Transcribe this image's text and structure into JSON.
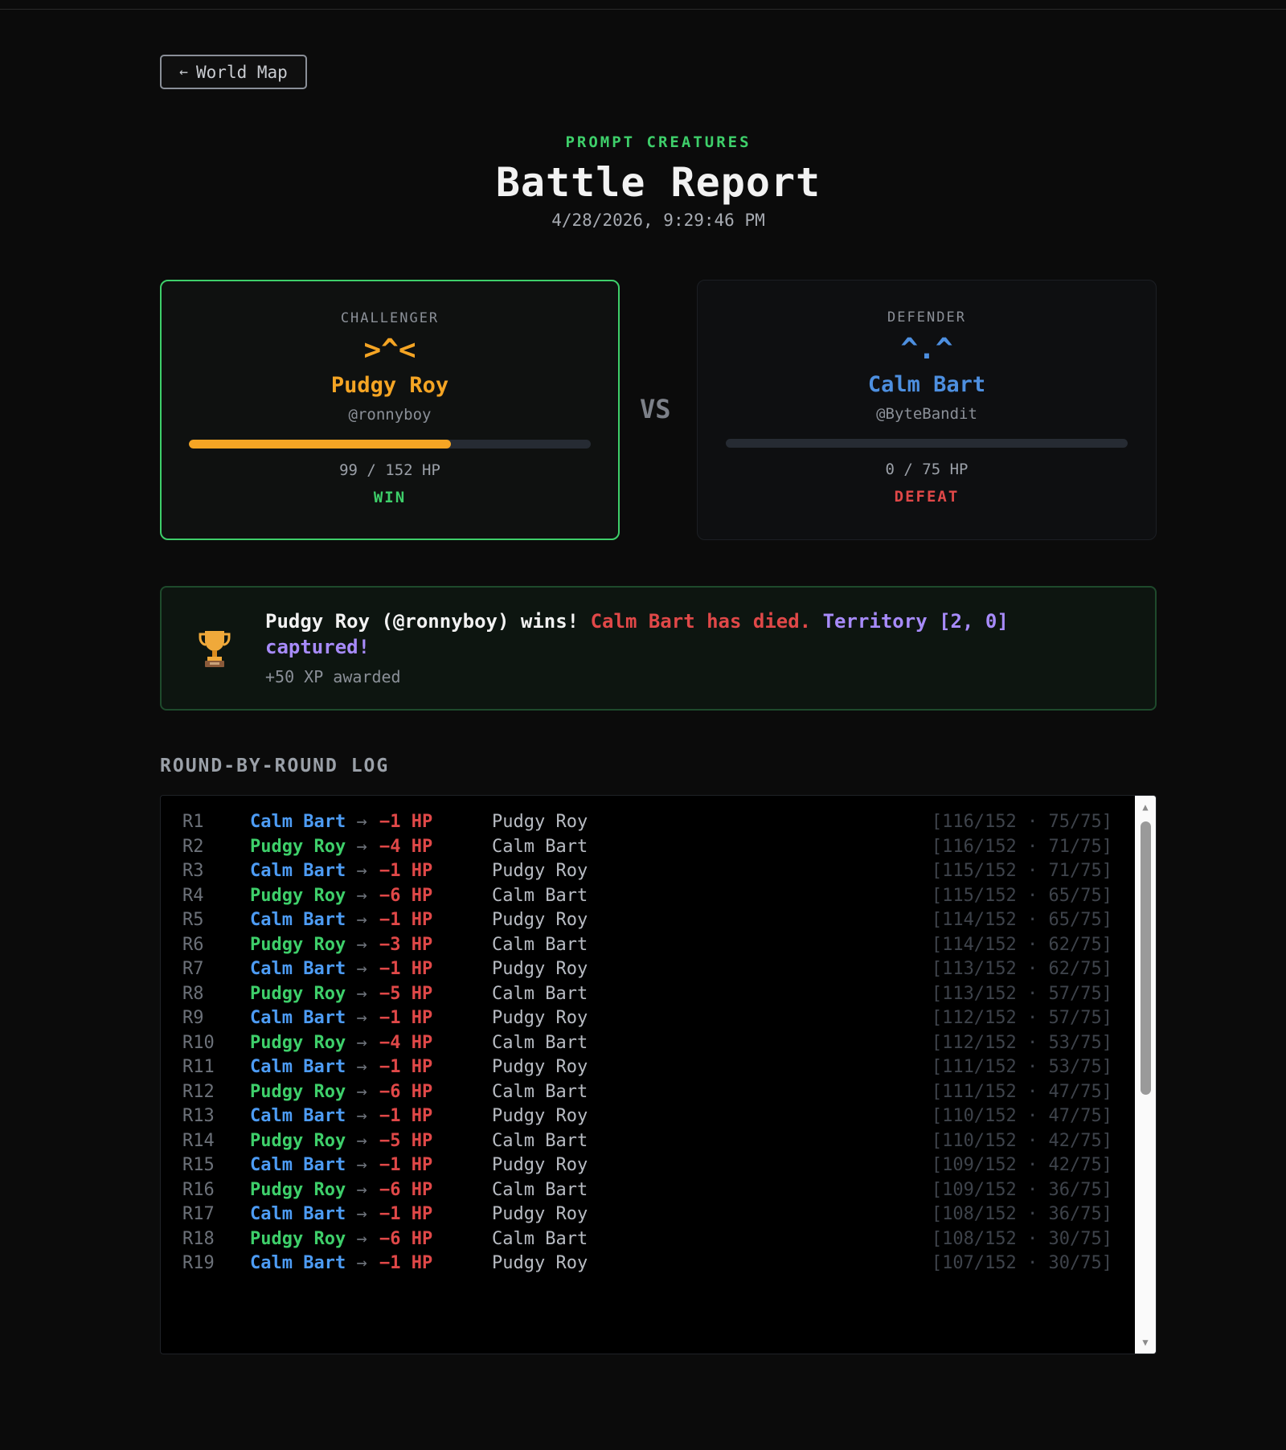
{
  "nav": {
    "back_arrow": "←",
    "back_label": "World Map"
  },
  "header": {
    "eyebrow": "PROMPT CREATURES",
    "title": "Battle Report",
    "date": "4/28/2026, 9:29:46 PM"
  },
  "challenger": {
    "role": "CHALLENGER",
    "face": ">^<",
    "name": "Pudgy Roy",
    "handle": "@ronnyboy",
    "hp_text": "99 / 152 HP",
    "hp_current": 99,
    "hp_max": 152,
    "outcome": "WIN",
    "color": "#f5a524"
  },
  "vs_label": "VS",
  "defender": {
    "role": "DEFENDER",
    "face": "^.^",
    "name": "Calm Bart",
    "handle": "@ByteBandit",
    "hp_text": "0 / 75 HP",
    "hp_current": 0,
    "hp_max": 75,
    "outcome": "DEFEAT",
    "color": "#4d8fe0"
  },
  "result": {
    "icon": "trophy-icon",
    "winner_text": "Pudgy Roy (@ronnyboy) wins!",
    "died_text": "Calm Bart has died.",
    "territory_text": "Territory [2, 0] captured!",
    "xp_text": "+50 XP awarded"
  },
  "log": {
    "title": "ROUND-BY-ROUND LOG",
    "arrow": "→",
    "rows": [
      {
        "round": "R1",
        "attacker": "Calm Bart",
        "side": "blue",
        "damage": "−1 HP",
        "target": "Pudgy Roy",
        "state": "[116/152 · 75/75]"
      },
      {
        "round": "R2",
        "attacker": "Pudgy Roy",
        "side": "green",
        "damage": "−4 HP",
        "target": "Calm Bart",
        "state": "[116/152 · 71/75]"
      },
      {
        "round": "R3",
        "attacker": "Calm Bart",
        "side": "blue",
        "damage": "−1 HP",
        "target": "Pudgy Roy",
        "state": "[115/152 · 71/75]"
      },
      {
        "round": "R4",
        "attacker": "Pudgy Roy",
        "side": "green",
        "damage": "−6 HP",
        "target": "Calm Bart",
        "state": "[115/152 · 65/75]"
      },
      {
        "round": "R5",
        "attacker": "Calm Bart",
        "side": "blue",
        "damage": "−1 HP",
        "target": "Pudgy Roy",
        "state": "[114/152 · 65/75]"
      },
      {
        "round": "R6",
        "attacker": "Pudgy Roy",
        "side": "green",
        "damage": "−3 HP",
        "target": "Calm Bart",
        "state": "[114/152 · 62/75]"
      },
      {
        "round": "R7",
        "attacker": "Calm Bart",
        "side": "blue",
        "damage": "−1 HP",
        "target": "Pudgy Roy",
        "state": "[113/152 · 62/75]"
      },
      {
        "round": "R8",
        "attacker": "Pudgy Roy",
        "side": "green",
        "damage": "−5 HP",
        "target": "Calm Bart",
        "state": "[113/152 · 57/75]"
      },
      {
        "round": "R9",
        "attacker": "Calm Bart",
        "side": "blue",
        "damage": "−1 HP",
        "target": "Pudgy Roy",
        "state": "[112/152 · 57/75]"
      },
      {
        "round": "R10",
        "attacker": "Pudgy Roy",
        "side": "green",
        "damage": "−4 HP",
        "target": "Calm Bart",
        "state": "[112/152 · 53/75]"
      },
      {
        "round": "R11",
        "attacker": "Calm Bart",
        "side": "blue",
        "damage": "−1 HP",
        "target": "Pudgy Roy",
        "state": "[111/152 · 53/75]"
      },
      {
        "round": "R12",
        "attacker": "Pudgy Roy",
        "side": "green",
        "damage": "−6 HP",
        "target": "Calm Bart",
        "state": "[111/152 · 47/75]"
      },
      {
        "round": "R13",
        "attacker": "Calm Bart",
        "side": "blue",
        "damage": "−1 HP",
        "target": "Pudgy Roy",
        "state": "[110/152 · 47/75]"
      },
      {
        "round": "R14",
        "attacker": "Pudgy Roy",
        "side": "green",
        "damage": "−5 HP",
        "target": "Calm Bart",
        "state": "[110/152 · 42/75]"
      },
      {
        "round": "R15",
        "attacker": "Calm Bart",
        "side": "blue",
        "damage": "−1 HP",
        "target": "Pudgy Roy",
        "state": "[109/152 · 42/75]"
      },
      {
        "round": "R16",
        "attacker": "Pudgy Roy",
        "side": "green",
        "damage": "−6 HP",
        "target": "Calm Bart",
        "state": "[109/152 · 36/75]"
      },
      {
        "round": "R17",
        "attacker": "Calm Bart",
        "side": "blue",
        "damage": "−1 HP",
        "target": "Pudgy Roy",
        "state": "[108/152 · 36/75]"
      },
      {
        "round": "R18",
        "attacker": "Pudgy Roy",
        "side": "green",
        "damage": "−6 HP",
        "target": "Calm Bart",
        "state": "[108/152 · 30/75]"
      },
      {
        "round": "R19",
        "attacker": "Calm Bart",
        "side": "blue",
        "damage": "−1 HP",
        "target": "Pudgy Roy",
        "state": "[107/152 · 30/75]"
      }
    ]
  },
  "colors": {
    "win": "#3ecf6a",
    "loss": "#e04848",
    "territory": "#a78bfa",
    "challenger": "#f5a524",
    "defender": "#4d8fe0"
  }
}
